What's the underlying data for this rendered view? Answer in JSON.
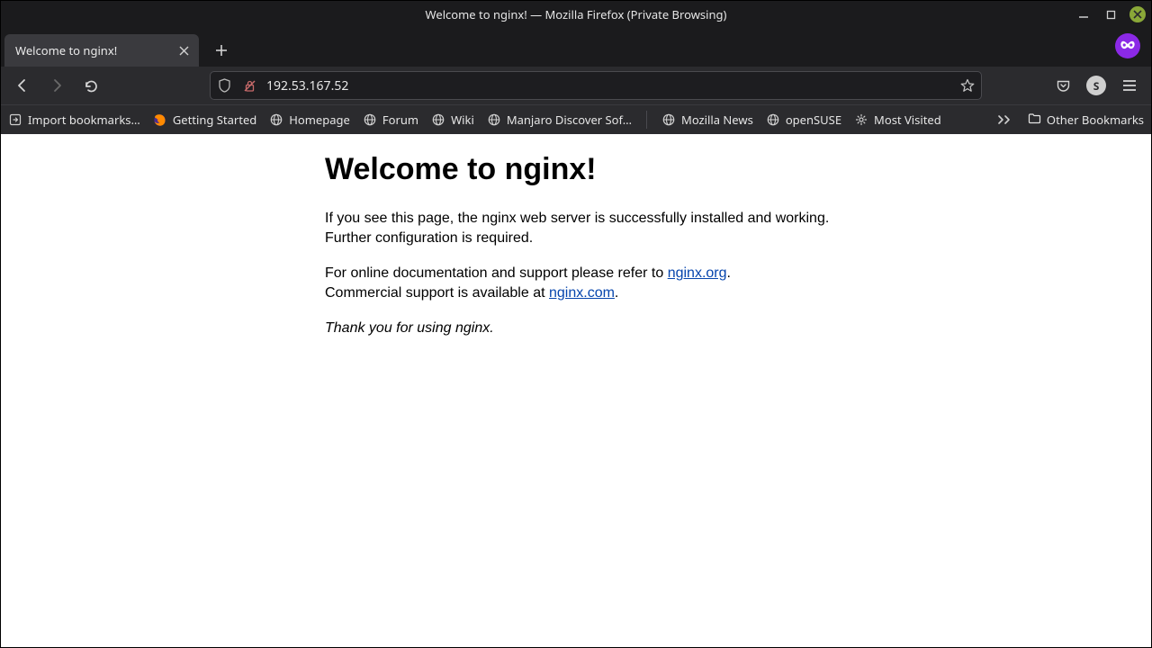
{
  "window": {
    "title": "Welcome to nginx! — Mozilla Firefox (Private Browsing)"
  },
  "tabs": [
    {
      "label": "Welcome to nginx!"
    }
  ],
  "url": "192.53.167.52",
  "bookmarks": {
    "import": "Import bookmarks…",
    "items": [
      "Getting Started",
      "Homepage",
      "Forum",
      "Wiki",
      "Manjaro Discover Sof…",
      "Mozilla News",
      "openSUSE",
      "Most Visited"
    ],
    "other": "Other Bookmarks"
  },
  "account_initial": "S",
  "content": {
    "heading": "Welcome to nginx!",
    "p1": "If you see this page, the nginx web server is successfully installed and working. Further configuration is required.",
    "p2a": "For online documentation and support please refer to ",
    "p2_link1": "nginx.org",
    "p2b": ".",
    "p3a": "Commercial support is available at ",
    "p3_link": "nginx.com",
    "p3b": ".",
    "p4": "Thank you for using nginx."
  }
}
